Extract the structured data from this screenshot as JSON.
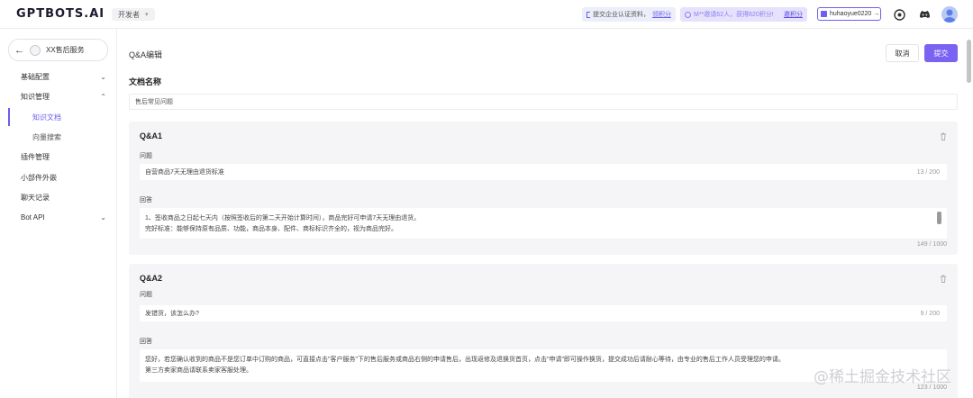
{
  "header": {
    "logo": "GPTBOTS.AI",
    "env": "开发者",
    "promo1": {
      "text": "提交企业认证资料，",
      "link": "领积分"
    },
    "promo2": {
      "text": "M**邀请62人，获得620积分!",
      "link": "邀积分"
    },
    "user": "huhaoyue0220 →"
  },
  "sidebar": {
    "bot_name": "XX售后服务",
    "items": [
      {
        "label": "基础配置"
      },
      {
        "label": "知识管理"
      },
      {
        "label": "知识文档"
      },
      {
        "label": "向量搜索"
      },
      {
        "label": "插件管理"
      },
      {
        "label": "小部件外嵌"
      },
      {
        "label": "聊天记录"
      },
      {
        "label": "Bot API"
      }
    ]
  },
  "main": {
    "title": "Q&A编辑",
    "cancel_label": "取消",
    "submit_label": "提交",
    "doc_name_label": "文档名称",
    "doc_name_value": "售后常见问题",
    "qa": [
      {
        "title": "Q&A1",
        "question_label": "问题",
        "question": "自营商品7天无理由退货标准",
        "question_count": "13 / 200",
        "answer_label": "回答",
        "answer_lines": [
          "1、签收商品之日起七天内（按照签收后的第二天开始计算时间），商品完好可申请7天无理由退货。",
          "完好标准：能够保持原有品质、功能，商品本身、配件、商标标识齐全的，视为商品完好。"
        ],
        "answer_count": "149 / 1000"
      },
      {
        "title": "Q&A2",
        "question_label": "问题",
        "question": "发错货，该怎么办?",
        "question_count": "9 / 200",
        "answer_label": "回答",
        "answer_lines": [
          "您好，若您确认收到的商品不是您订单中订购的商品，可直接点击\"客户服务\"下的售后服务或商品右侧的申请售后，出现返修及退换货首页，点击\"申请\"即可操作换货，提交成功后请耐心等待，由专业的售后工作人员受理您的申请。",
          "第三方卖家商品请联系卖家客服处理。"
        ],
        "answer_count": "123 / 1000"
      }
    ]
  },
  "watermark": "@稀土掘金技术社区"
}
